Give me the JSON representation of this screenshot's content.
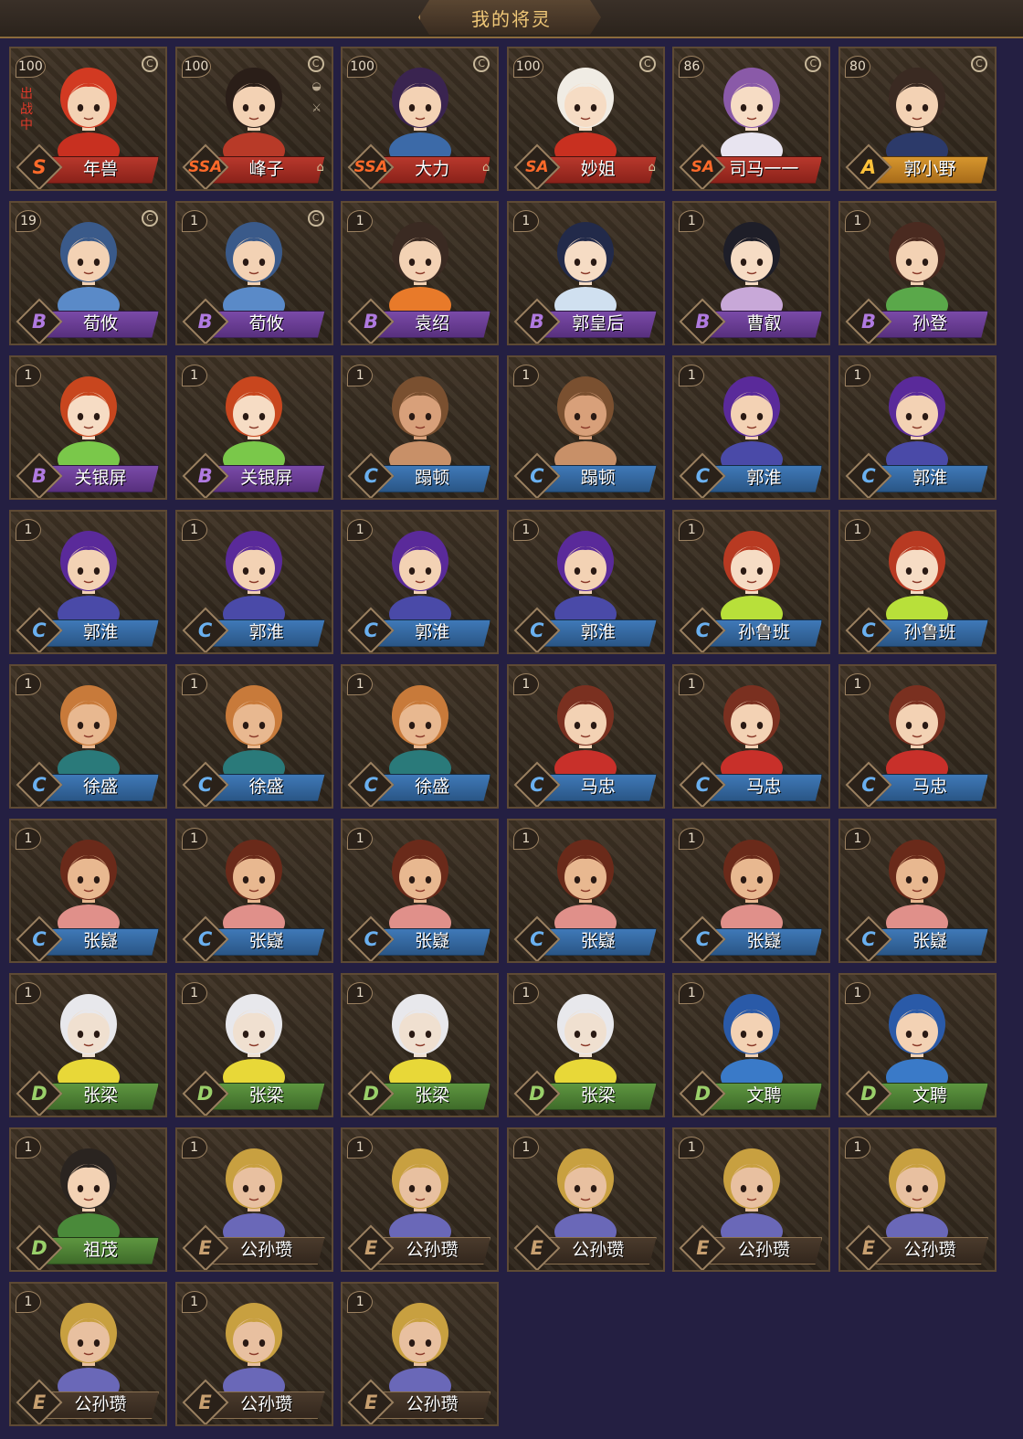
{
  "header": {
    "title": "我的将灵"
  },
  "deploy_label": "出战中",
  "coin_glyph": "C",
  "lock_glyph": "🔒",
  "cards": [
    {
      "level": "100",
      "grade": "S",
      "name": "年兽",
      "deployed": true,
      "coin": true,
      "locked": false,
      "hair": "#d23a22",
      "robe": "#c83020",
      "skin": "#f3d2b4"
    },
    {
      "level": "100",
      "grade": "SSA",
      "name": "峰子",
      "coin": true,
      "locked": true,
      "extra_icons": true,
      "hair": "#2a1e18",
      "robe": "#b83a28",
      "skin": "#f3d2b4"
    },
    {
      "level": "100",
      "grade": "SSA",
      "name": "大力",
      "coin": true,
      "locked": true,
      "hair": "#3a2450",
      "robe": "#3c6aa8",
      "skin": "#f3d2b4"
    },
    {
      "level": "100",
      "grade": "SA",
      "name": "妙姐",
      "coin": true,
      "locked": true,
      "hair": "#f0ece4",
      "robe": "#c83020",
      "skin": "#f6dcc4"
    },
    {
      "level": "86",
      "grade": "SA",
      "name": "司马一一",
      "coin": true,
      "locked": false,
      "hair": "#8a5aa8",
      "robe": "#e8e4f0",
      "skin": "#f6dcc4"
    },
    {
      "level": "80",
      "grade": "A",
      "name": "郭小野",
      "coin": true,
      "locked": false,
      "hair": "#3a2a22",
      "robe": "#2c3a6a",
      "skin": "#f3d2b4"
    },
    {
      "level": "19",
      "grade": "B",
      "name": "荀攸",
      "coin": true,
      "hair": "#3a5a8a",
      "robe": "#5a8ac8",
      "skin": "#f3d2b4"
    },
    {
      "level": "1",
      "grade": "B",
      "name": "荀攸",
      "coin": true,
      "hair": "#3a5a8a",
      "robe": "#5a8ac8",
      "skin": "#f3d2b4"
    },
    {
      "level": "1",
      "grade": "B",
      "name": "袁绍",
      "hair": "#3a2a22",
      "robe": "#e87a2a",
      "skin": "#f3d2b4"
    },
    {
      "level": "1",
      "grade": "B",
      "name": "郭皇后",
      "hair": "#222a4a",
      "robe": "#d0e0f0",
      "skin": "#f6dcc4"
    },
    {
      "level": "1",
      "grade": "B",
      "name": "曹叡",
      "hair": "#1e1e28",
      "robe": "#c8a8d8",
      "skin": "#f6dcc4"
    },
    {
      "level": "1",
      "grade": "B",
      "name": "孙登",
      "hair": "#4a2a20",
      "robe": "#5aa84a",
      "skin": "#f3d2b4"
    },
    {
      "level": "1",
      "grade": "B",
      "name": "关银屏",
      "hair": "#c8461e",
      "robe": "#7ac84a",
      "skin": "#f6dcc4"
    },
    {
      "level": "1",
      "grade": "B",
      "name": "关银屏",
      "hair": "#c8461e",
      "robe": "#7ac84a",
      "skin": "#f6dcc4"
    },
    {
      "level": "1",
      "grade": "C",
      "name": "蹋顿",
      "hair": "#7a5030",
      "robe": "#c89068",
      "skin": "#d8a07a"
    },
    {
      "level": "1",
      "grade": "C",
      "name": "蹋顿",
      "hair": "#7a5030",
      "robe": "#c89068",
      "skin": "#d8a07a"
    },
    {
      "level": "1",
      "grade": "C",
      "name": "郭淮",
      "hair": "#5a2a9a",
      "robe": "#4a4aa8",
      "skin": "#f3d2b4"
    },
    {
      "level": "1",
      "grade": "C",
      "name": "郭淮",
      "hair": "#5a2a9a",
      "robe": "#4a4aa8",
      "skin": "#f3d2b4"
    },
    {
      "level": "1",
      "grade": "C",
      "name": "郭淮",
      "hair": "#5a2a9a",
      "robe": "#4a4aa8",
      "skin": "#f3d2b4"
    },
    {
      "level": "1",
      "grade": "C",
      "name": "郭淮",
      "hair": "#5a2a9a",
      "robe": "#4a4aa8",
      "skin": "#f3d2b4"
    },
    {
      "level": "1",
      "grade": "C",
      "name": "郭淮",
      "hair": "#5a2a9a",
      "robe": "#4a4aa8",
      "skin": "#f3d2b4"
    },
    {
      "level": "1",
      "grade": "C",
      "name": "郭淮",
      "hair": "#5a2a9a",
      "robe": "#4a4aa8",
      "skin": "#f3d2b4"
    },
    {
      "level": "1",
      "grade": "C",
      "name": "孙鲁班",
      "hair": "#b83a22",
      "robe": "#b8e03a",
      "skin": "#f6dcc4"
    },
    {
      "level": "1",
      "grade": "C",
      "name": "孙鲁班",
      "hair": "#b83a22",
      "robe": "#b8e03a",
      "skin": "#f6dcc4"
    },
    {
      "level": "1",
      "grade": "C",
      "name": "徐盛",
      "hair": "#c87a3a",
      "robe": "#2a7a7a",
      "skin": "#e8b890"
    },
    {
      "level": "1",
      "grade": "C",
      "name": "徐盛",
      "hair": "#c87a3a",
      "robe": "#2a7a7a",
      "skin": "#e8b890"
    },
    {
      "level": "1",
      "grade": "C",
      "name": "徐盛",
      "hair": "#c87a3a",
      "robe": "#2a7a7a",
      "skin": "#e8b890"
    },
    {
      "level": "1",
      "grade": "C",
      "name": "马忠",
      "hair": "#7a3020",
      "robe": "#c8302a",
      "skin": "#f3d2b4"
    },
    {
      "level": "1",
      "grade": "C",
      "name": "马忠",
      "hair": "#7a3020",
      "robe": "#c8302a",
      "skin": "#f3d2b4"
    },
    {
      "level": "1",
      "grade": "C",
      "name": "马忠",
      "hair": "#7a3020",
      "robe": "#c8302a",
      "skin": "#f3d2b4"
    },
    {
      "level": "1",
      "grade": "C",
      "name": "张嶷",
      "hair": "#6a2a1a",
      "robe": "#e0908a",
      "skin": "#e8b890"
    },
    {
      "level": "1",
      "grade": "C",
      "name": "张嶷",
      "hair": "#6a2a1a",
      "robe": "#e0908a",
      "skin": "#e8b890"
    },
    {
      "level": "1",
      "grade": "C",
      "name": "张嶷",
      "hair": "#6a2a1a",
      "robe": "#e0908a",
      "skin": "#e8b890"
    },
    {
      "level": "1",
      "grade": "C",
      "name": "张嶷",
      "hair": "#6a2a1a",
      "robe": "#e0908a",
      "skin": "#e8b890"
    },
    {
      "level": "1",
      "grade": "C",
      "name": "张嶷",
      "hair": "#6a2a1a",
      "robe": "#e0908a",
      "skin": "#e8b890"
    },
    {
      "level": "1",
      "grade": "C",
      "name": "张嶷",
      "hair": "#6a2a1a",
      "robe": "#e0908a",
      "skin": "#e8b890"
    },
    {
      "level": "1",
      "grade": "D",
      "name": "张梁",
      "hair": "#e8e8ec",
      "robe": "#e8d838",
      "skin": "#f0e0d0"
    },
    {
      "level": "1",
      "grade": "D",
      "name": "张梁",
      "hair": "#e8e8ec",
      "robe": "#e8d838",
      "skin": "#f0e0d0"
    },
    {
      "level": "1",
      "grade": "D",
      "name": "张梁",
      "hair": "#e8e8ec",
      "robe": "#e8d838",
      "skin": "#f0e0d0"
    },
    {
      "level": "1",
      "grade": "D",
      "name": "张梁",
      "hair": "#e8e8ec",
      "robe": "#e8d838",
      "skin": "#f0e0d0"
    },
    {
      "level": "1",
      "grade": "D",
      "name": "文聘",
      "hair": "#2a5aa8",
      "robe": "#3a7ac8",
      "skin": "#f3d2b4"
    },
    {
      "level": "1",
      "grade": "D",
      "name": "文聘",
      "hair": "#2a5aa8",
      "robe": "#3a7ac8",
      "skin": "#f3d2b4"
    },
    {
      "level": "1",
      "grade": "D",
      "name": "祖茂",
      "hair": "#2a2420",
      "robe": "#4a8a3a",
      "skin": "#f3d2b4"
    },
    {
      "level": "1",
      "grade": "E",
      "name": "公孙瓒",
      "hair": "#c8a040",
      "robe": "#6a68b8",
      "skin": "#e8c0a0"
    },
    {
      "level": "1",
      "grade": "E",
      "name": "公孙瓒",
      "hair": "#c8a040",
      "robe": "#6a68b8",
      "skin": "#e8c0a0"
    },
    {
      "level": "1",
      "grade": "E",
      "name": "公孙瓒",
      "hair": "#c8a040",
      "robe": "#6a68b8",
      "skin": "#e8c0a0"
    },
    {
      "level": "1",
      "grade": "E",
      "name": "公孙瓒",
      "hair": "#c8a040",
      "robe": "#6a68b8",
      "skin": "#e8c0a0"
    },
    {
      "level": "1",
      "grade": "E",
      "name": "公孙瓒",
      "hair": "#c8a040",
      "robe": "#6a68b8",
      "skin": "#e8c0a0"
    },
    {
      "level": "1",
      "grade": "E",
      "name": "公孙瓒",
      "hair": "#c8a040",
      "robe": "#6a68b8",
      "skin": "#e8c0a0"
    },
    {
      "level": "1",
      "grade": "E",
      "name": "公孙瓒",
      "hair": "#c8a040",
      "robe": "#6a68b8",
      "skin": "#e8c0a0"
    },
    {
      "level": "1",
      "grade": "E",
      "name": "公孙瓒",
      "hair": "#c8a040",
      "robe": "#6a68b8",
      "skin": "#e8c0a0"
    }
  ]
}
